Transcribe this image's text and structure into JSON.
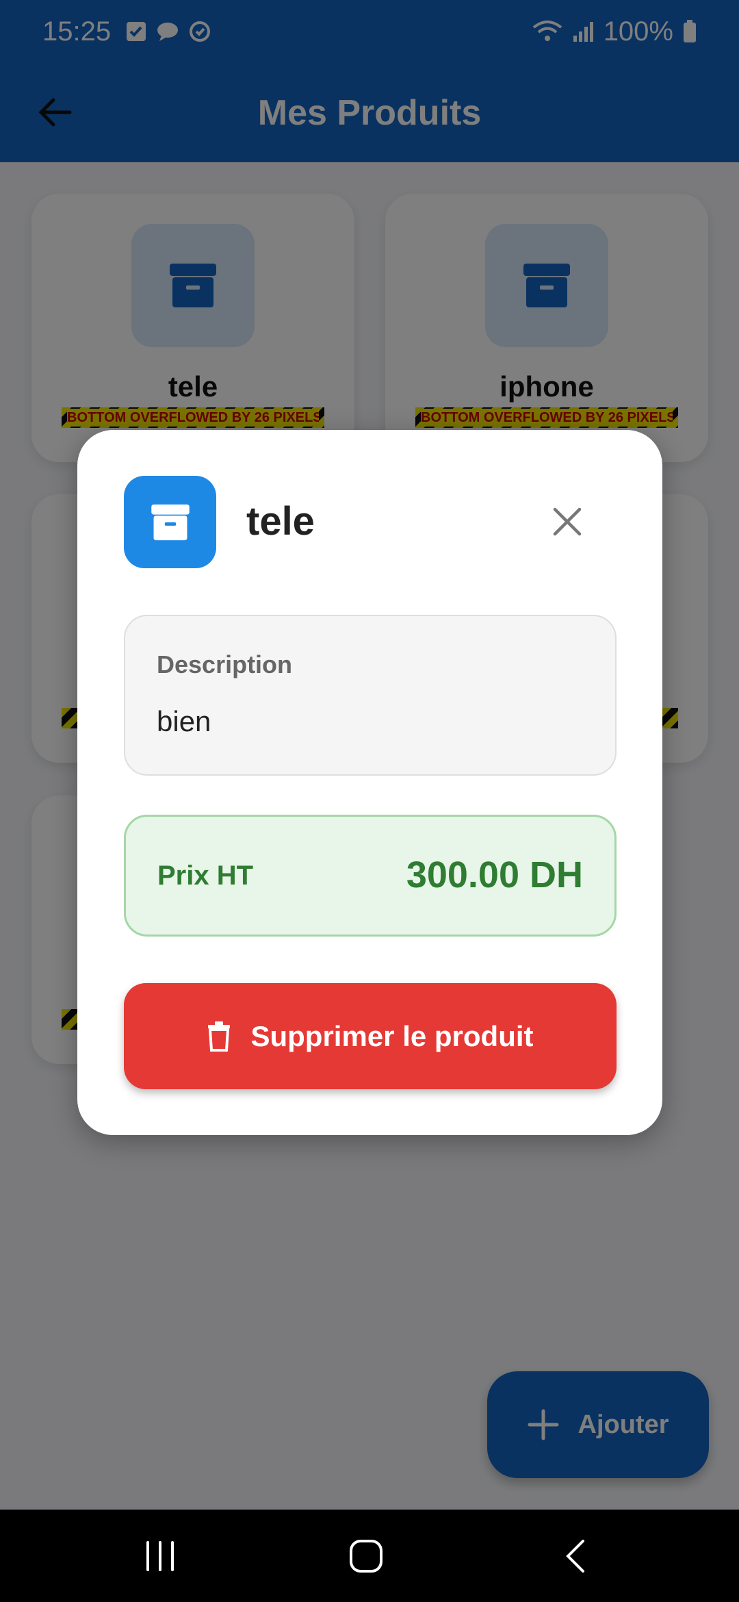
{
  "status_bar": {
    "time": "15:25",
    "battery": "100%"
  },
  "app_bar": {
    "title": "Mes Produits"
  },
  "products": [
    {
      "name": "tele",
      "overflow_text": "BOTTOM OVERFLOWED BY 26 PIXELS"
    },
    {
      "name": "iphone",
      "overflow_text": "BOTTOM OVERFLOWED BY 26 PIXELS"
    },
    {
      "name": "",
      "overflow_text": ""
    },
    {
      "name": "",
      "overflow_text": ""
    },
    {
      "name": "",
      "overflow_text": ""
    }
  ],
  "fab": {
    "label": "Ajouter"
  },
  "dialog": {
    "title": "tele",
    "description_label": "Description",
    "description_value": "bien",
    "price_label": "Prix HT",
    "price_value": "300.00 DH",
    "delete_label": "Supprimer le produit"
  },
  "colors": {
    "primary": "#1565c0",
    "danger": "#e53935",
    "success": "#2e7d32"
  }
}
